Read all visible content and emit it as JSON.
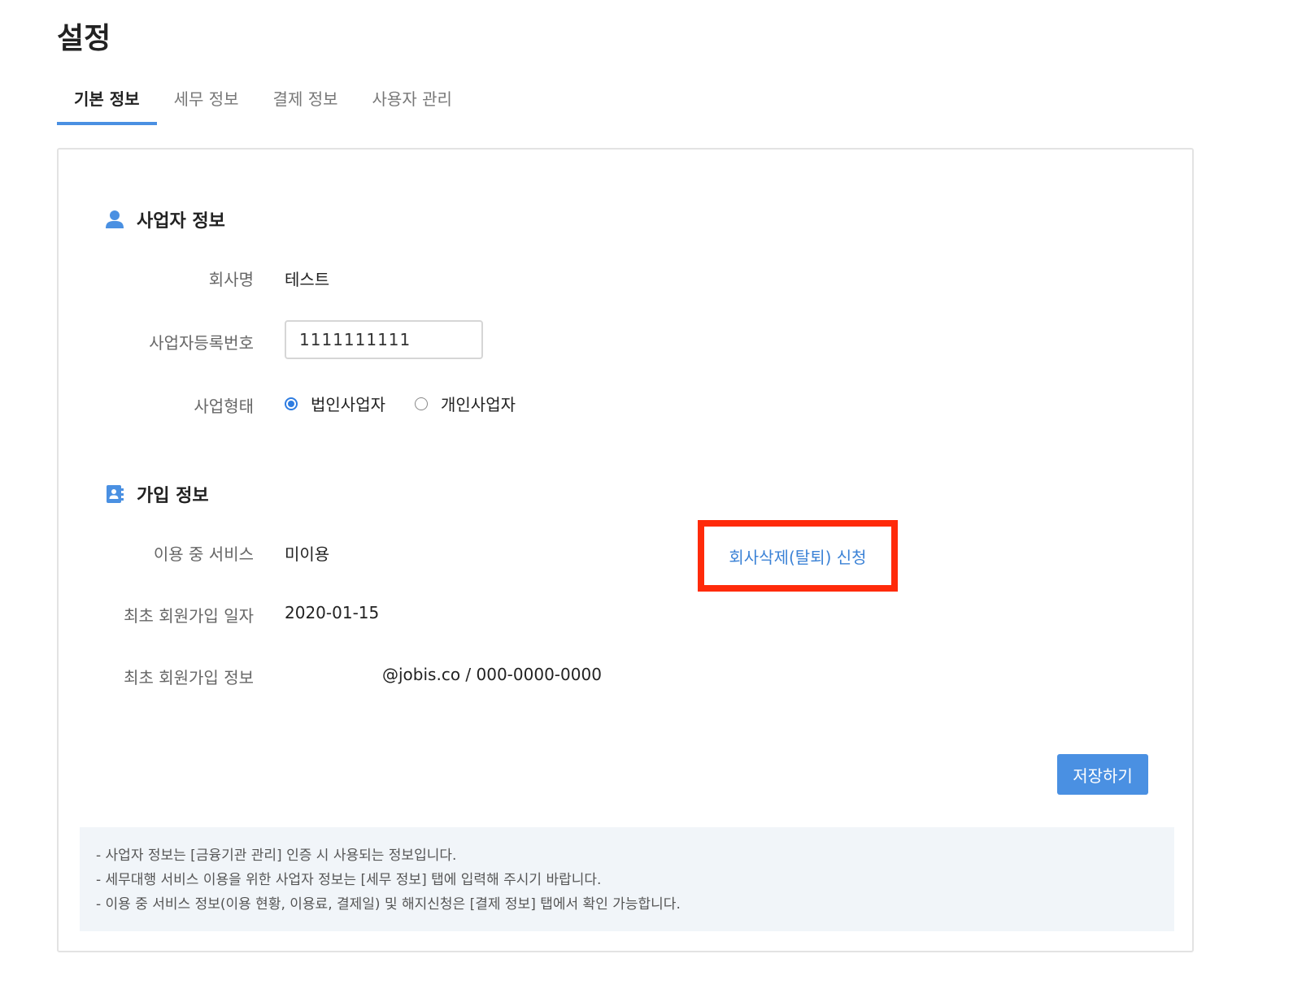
{
  "page": {
    "title": "설정"
  },
  "tabs": [
    {
      "label": "기본 정보",
      "active": true
    },
    {
      "label": "세무 정보",
      "active": false
    },
    {
      "label": "결제 정보",
      "active": false
    },
    {
      "label": "사용자 관리",
      "active": false
    }
  ],
  "business": {
    "heading": "사업자 정보",
    "icon": "user-icon",
    "company_label": "회사명",
    "company_value": "테스트",
    "regno_label": "사업자등록번호",
    "regno_value": "1111111111",
    "type_label": "사업형태",
    "type_options": [
      {
        "label": "법인사업자",
        "selected": true
      },
      {
        "label": "개인사업자",
        "selected": false
      }
    ]
  },
  "signup": {
    "heading": "가입 정보",
    "icon": "contact-book-icon",
    "service_label": "이용 중 서비스",
    "service_value": "미이용",
    "withdraw_link": "회사삭제(탈퇴) 신청",
    "date_label": "최초 회원가입 일자",
    "date_value": "2020-01-15",
    "info_label": "최초 회원가입 정보",
    "info_value": "@jobis.co / 000-0000-0000"
  },
  "actions": {
    "save_label": "저장하기"
  },
  "notices": [
    "- 사업자 정보는 [금융기관 관리] 인증 시 사용되는 정보입니다.",
    "- 세무대행 서비스 이용을 위한 사업자 정보는 [세무 정보] 탭에 입력해 주시기 바랍니다.",
    "- 이용 중 서비스 정보(이용 현황, 이용료, 결제일) 및 해지신청은 [결제 정보] 탭에서 확인 가능합니다."
  ],
  "colors": {
    "accent": "#4a90e2",
    "highlight_border": "#ff2a0a",
    "link": "#3b82d6"
  }
}
